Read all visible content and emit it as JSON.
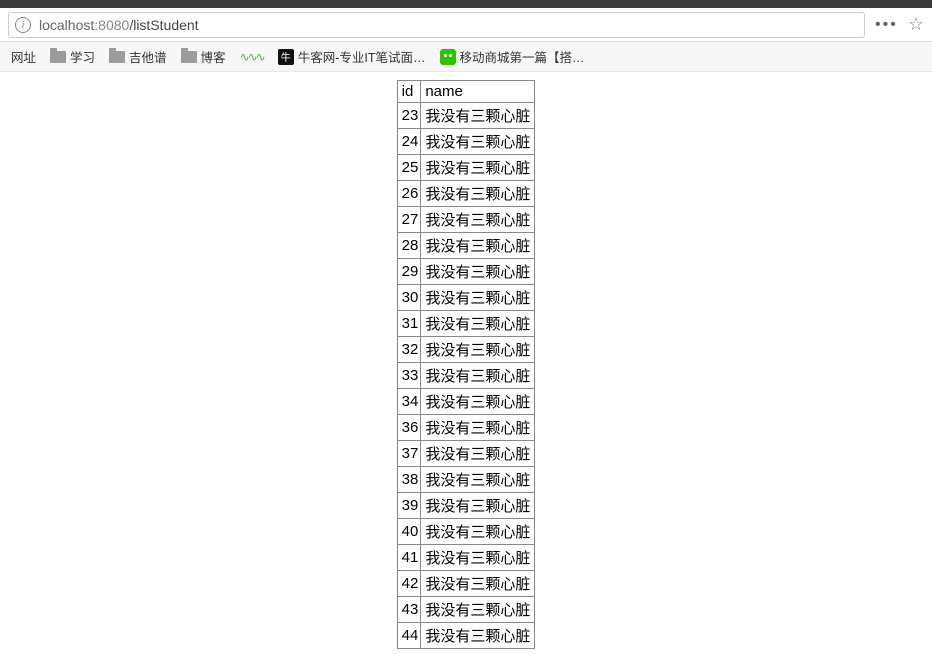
{
  "url": {
    "host": "localhost",
    "port": ":8080",
    "path": "/listStudent"
  },
  "bookmarks": {
    "label0": "网址",
    "items": [
      {
        "label": "学习",
        "type": "folder"
      },
      {
        "label": "吉他谱",
        "type": "folder"
      },
      {
        "label": "博客",
        "type": "folder"
      },
      {
        "label": "",
        "type": "wave"
      },
      {
        "label": "牛客网-专业IT笔试面…",
        "type": "site"
      },
      {
        "label": "移动商城第一篇【搭…",
        "type": "wechat"
      }
    ]
  },
  "table": {
    "headers": {
      "id": "id",
      "name": "name"
    },
    "rows": [
      {
        "id": "23",
        "name": "我没有三颗心脏"
      },
      {
        "id": "24",
        "name": "我没有三颗心脏"
      },
      {
        "id": "25",
        "name": "我没有三颗心脏"
      },
      {
        "id": "26",
        "name": "我没有三颗心脏"
      },
      {
        "id": "27",
        "name": "我没有三颗心脏"
      },
      {
        "id": "28",
        "name": "我没有三颗心脏"
      },
      {
        "id": "29",
        "name": "我没有三颗心脏"
      },
      {
        "id": "30",
        "name": "我没有三颗心脏"
      },
      {
        "id": "31",
        "name": "我没有三颗心脏"
      },
      {
        "id": "32",
        "name": "我没有三颗心脏"
      },
      {
        "id": "33",
        "name": "我没有三颗心脏"
      },
      {
        "id": "34",
        "name": "我没有三颗心脏"
      },
      {
        "id": "36",
        "name": "我没有三颗心脏"
      },
      {
        "id": "37",
        "name": "我没有三颗心脏"
      },
      {
        "id": "38",
        "name": "我没有三颗心脏"
      },
      {
        "id": "39",
        "name": "我没有三颗心脏"
      },
      {
        "id": "40",
        "name": "我没有三颗心脏"
      },
      {
        "id": "41",
        "name": "我没有三颗心脏"
      },
      {
        "id": "42",
        "name": "我没有三颗心脏"
      },
      {
        "id": "43",
        "name": "我没有三颗心脏"
      },
      {
        "id": "44",
        "name": "我没有三颗心脏"
      }
    ]
  }
}
